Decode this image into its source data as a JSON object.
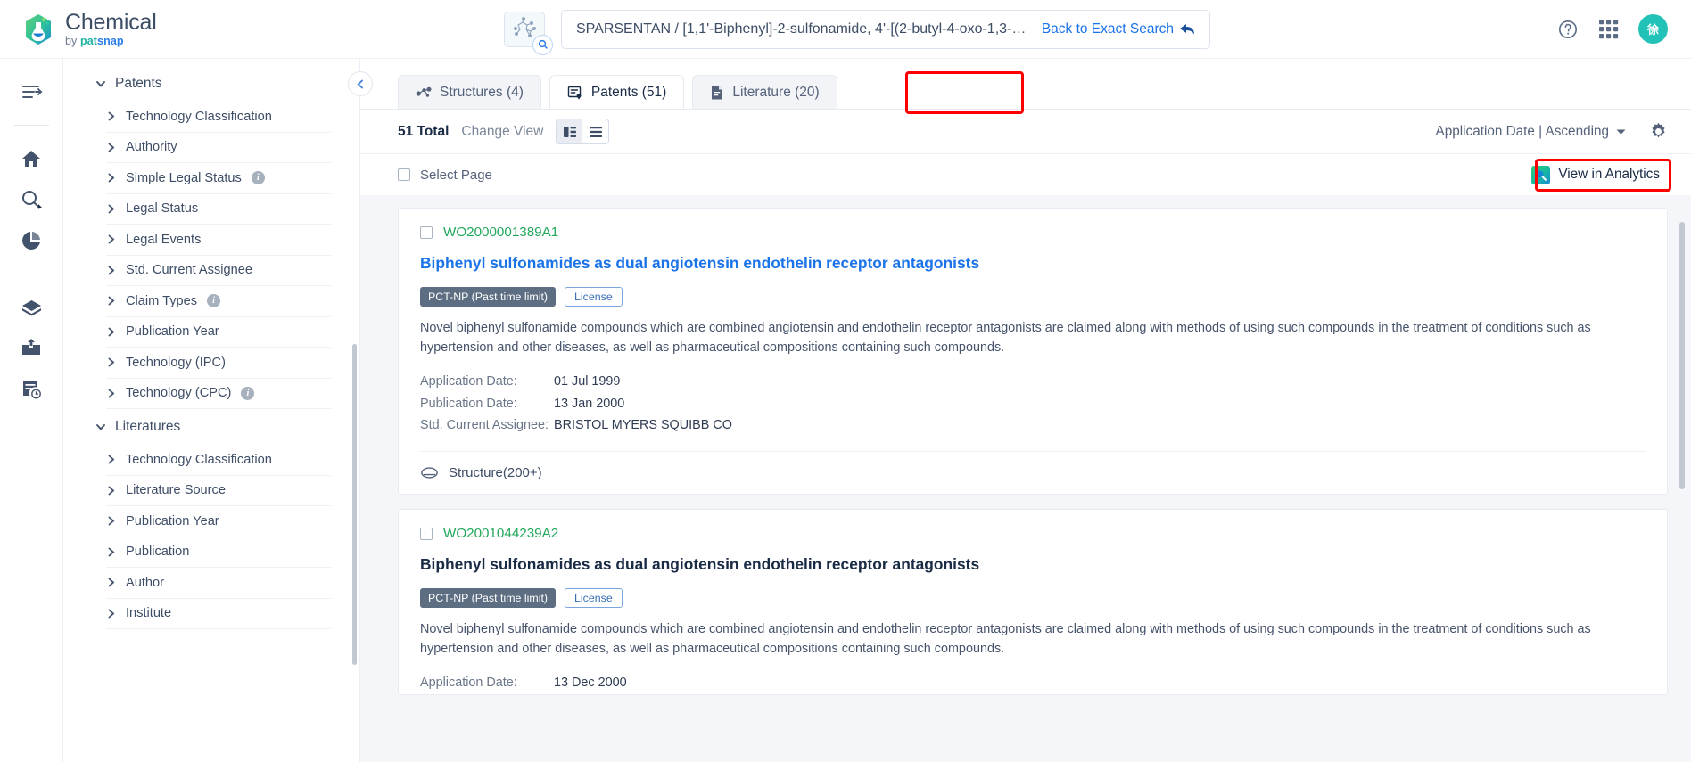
{
  "brand": {
    "name": "Chemical",
    "by": "by",
    "pat": "pat",
    "snap": "snap"
  },
  "search": {
    "value": "SPARSENTAN / [1,1'-Biphenyl]-2-sulfonamide, 4'-[(2-butyl-4-oxo-1,3-dia…",
    "back_to_exact": "Back to Exact Search",
    "structure_icon": "molecule-icon",
    "structure_badge_icon": "magnifier-icon"
  },
  "top_right": {
    "help_icon": "help-circle-icon",
    "apps_icon": "apps-grid-icon",
    "avatar_label": "徐"
  },
  "rail": {
    "items": [
      {
        "icon": "expand-panel-icon",
        "name": "expand-panel"
      },
      {
        "icon": "home-icon",
        "name": "home"
      },
      {
        "icon": "search-icon",
        "name": "search"
      },
      {
        "icon": "pie-chart-icon",
        "name": "analytics"
      },
      {
        "icon": "box-icon",
        "name": "workspace"
      },
      {
        "icon": "inbox-upload-icon",
        "name": "uploads"
      },
      {
        "icon": "list-clock-icon",
        "name": "history"
      }
    ]
  },
  "filters": {
    "groups": [
      {
        "label": "Patents",
        "expanded": true,
        "items": [
          {
            "label": "Technology Classification",
            "info": false
          },
          {
            "label": "Authority",
            "info": false
          },
          {
            "label": "Simple Legal Status",
            "info": true
          },
          {
            "label": "Legal Status",
            "info": false
          },
          {
            "label": "Legal Events",
            "info": false
          },
          {
            "label": "Std. Current Assignee",
            "info": false
          },
          {
            "label": "Claim Types",
            "info": true
          },
          {
            "label": "Publication Year",
            "info": false
          },
          {
            "label": "Technology (IPC)",
            "info": false
          },
          {
            "label": "Technology (CPC)",
            "info": true
          }
        ]
      },
      {
        "label": "Literatures",
        "expanded": true,
        "items": [
          {
            "label": "Technology Classification",
            "info": false
          },
          {
            "label": "Literature Source",
            "info": false
          },
          {
            "label": "Publication Year",
            "info": false
          },
          {
            "label": "Publication",
            "info": false
          },
          {
            "label": "Author",
            "info": false
          },
          {
            "label": "Institute",
            "info": false
          }
        ]
      }
    ]
  },
  "tabs": [
    {
      "label": "Structures (4)",
      "icon": "molecule-icon",
      "active": false
    },
    {
      "label": "Patents (51)",
      "icon": "patent-doc-icon",
      "active": true,
      "highlighted": true
    },
    {
      "label": "Literature (20)",
      "icon": "literature-doc-icon",
      "active": false
    }
  ],
  "toolbar": {
    "total": "51 Total",
    "change_view": "Change View",
    "view_card_icon": "card-view-icon",
    "view_list_icon": "list-view-icon",
    "sort_label": "Application Date | Ascending",
    "sort_caret_icon": "caret-down-icon",
    "settings_icon": "gear-icon"
  },
  "select_bar": {
    "select_page": "Select Page",
    "analytics_label": "View in Analytics",
    "analytics_icon": "analytics-magnifier-icon",
    "highlighted": true
  },
  "results": [
    {
      "pub_number": "WO2000001389A1",
      "title": "Biphenyl sulfonamides as dual angiotensin endothelin receptor antagonists",
      "title_is_link": true,
      "chips": [
        {
          "label": "PCT-NP (Past time limit)",
          "style": "solid"
        },
        {
          "label": "License",
          "style": "outline"
        }
      ],
      "abstract": "Novel biphenyl sulfonamide compounds which are combined angiotensin and endothelin receptor antagonists are claimed along with methods of using such compounds in the treatment of conditions such as hypertension and other diseases, as well as pharmaceutical compositions containing such compounds.",
      "meta": [
        {
          "key": "Application Date:",
          "value": "01 Jul 1999"
        },
        {
          "key": "Publication Date:",
          "value": "13 Jan 2000"
        },
        {
          "key": "Std. Current Assignee:",
          "value": "BRISTOL MYERS SQUIBB CO"
        }
      ],
      "structure_label": "Structure(200+)",
      "structure_icon": "structure-icon"
    },
    {
      "pub_number": "WO2001044239A2",
      "title": "Biphenyl sulfonamides as dual angiotensin endothelin receptor antagonists",
      "title_is_link": false,
      "chips": [
        {
          "label": "PCT-NP (Past time limit)",
          "style": "solid"
        },
        {
          "label": "License",
          "style": "outline"
        }
      ],
      "abstract": "Novel biphenyl sulfonamide compounds which are combined angiotensin and endothelin receptor antagonists are claimed along with methods of using such compounds in the treatment of conditions such as hypertension and other diseases, as well as pharmaceutical compositions containing such compounds.",
      "meta": [
        {
          "key": "Application Date:",
          "value": "13 Dec 2000"
        }
      ],
      "structure_label": "",
      "structure_icon": ""
    }
  ],
  "colors": {
    "accent_blue": "#1a73e8",
    "green": "#22a75b",
    "highlight_red": "#ff0000",
    "teal": "#22c2b8"
  }
}
